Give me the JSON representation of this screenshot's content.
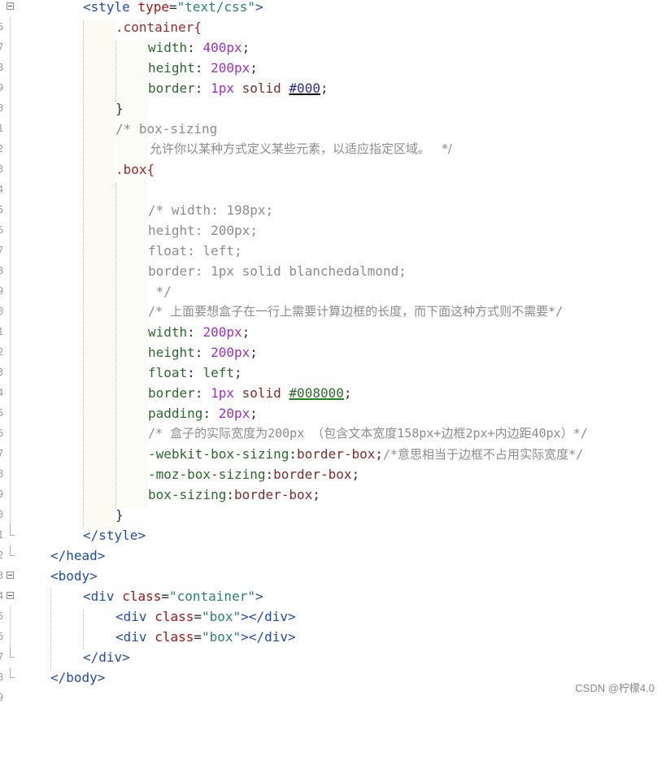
{
  "line_numbers": [
    "6",
    "7",
    "8",
    "9",
    "0",
    "1",
    "2",
    "3",
    "4",
    "5",
    "6",
    "7",
    "8",
    "9",
    "0",
    "1",
    "2",
    "3",
    "4",
    "5",
    "6",
    "7",
    "8",
    "9",
    "0",
    "1",
    "2",
    "3",
    "4",
    "5",
    "6",
    "7",
    "8",
    "9"
  ],
  "code": {
    "l1_style_open": {
      "tag": "style",
      "attr": "type",
      "val": "\"text/css\""
    },
    "l2_sel": ".container{",
    "l3": {
      "prop": "width",
      "val": "400px"
    },
    "l4": {
      "prop": "height",
      "val": "200px"
    },
    "l5": {
      "prop": "border",
      "v1": "1px",
      "v2": "solid",
      "hex": "#000"
    },
    "l6": "}",
    "l7": "/* box-sizing",
    "l8": "允许你以某种方式定义某些元素，以适应指定区域。   */",
    "l9_sel": ".box{",
    "l11": "/* width: 198px;",
    "l12": "height: 200px;",
    "l13": "float: left;",
    "l14": "border: 1px solid blanchedalmond;",
    "l15": " */",
    "l16": "/* 上面要想盒子在一行上需要计算边框的长度，而下面这种方式则不需要*/",
    "l17": {
      "prop": "width",
      "val": "200px"
    },
    "l18": {
      "prop": "height",
      "val": "200px"
    },
    "l19": {
      "prop": "float",
      "val": "left"
    },
    "l20": {
      "prop": "border",
      "v1": "1px",
      "v2": "solid",
      "hex": "#008000"
    },
    "l21": {
      "prop": "padding",
      "val": "20px"
    },
    "l22": "/* 盒子的实际宽度为200px （包含文本宽度158px+边框2px+内边距40px）*/",
    "l23": {
      "prop": "-webkit-box-sizing",
      "val": "border-box",
      "comment": "/*意思相当于边框不占用实际宽度*/"
    },
    "l24": {
      "prop": "-moz-box-sizing",
      "val": "border-box"
    },
    "l25": {
      "prop": "box-sizing",
      "val": "border-box"
    },
    "l26": "}",
    "l27_tag": "style",
    "l28_tag": "head",
    "l29_tag": "body",
    "l30": {
      "tag": "div",
      "attr": "class",
      "val": "\"container\""
    },
    "l31": {
      "tag": "div",
      "attr": "class",
      "val": "\"box\"",
      "close": "div"
    },
    "l32": {
      "tag": "div",
      "attr": "class",
      "val": "\"box\"",
      "close": "div"
    },
    "l33_tag": "div",
    "l34_tag": "body"
  },
  "watermark": "CSDN @柠檬4.0"
}
